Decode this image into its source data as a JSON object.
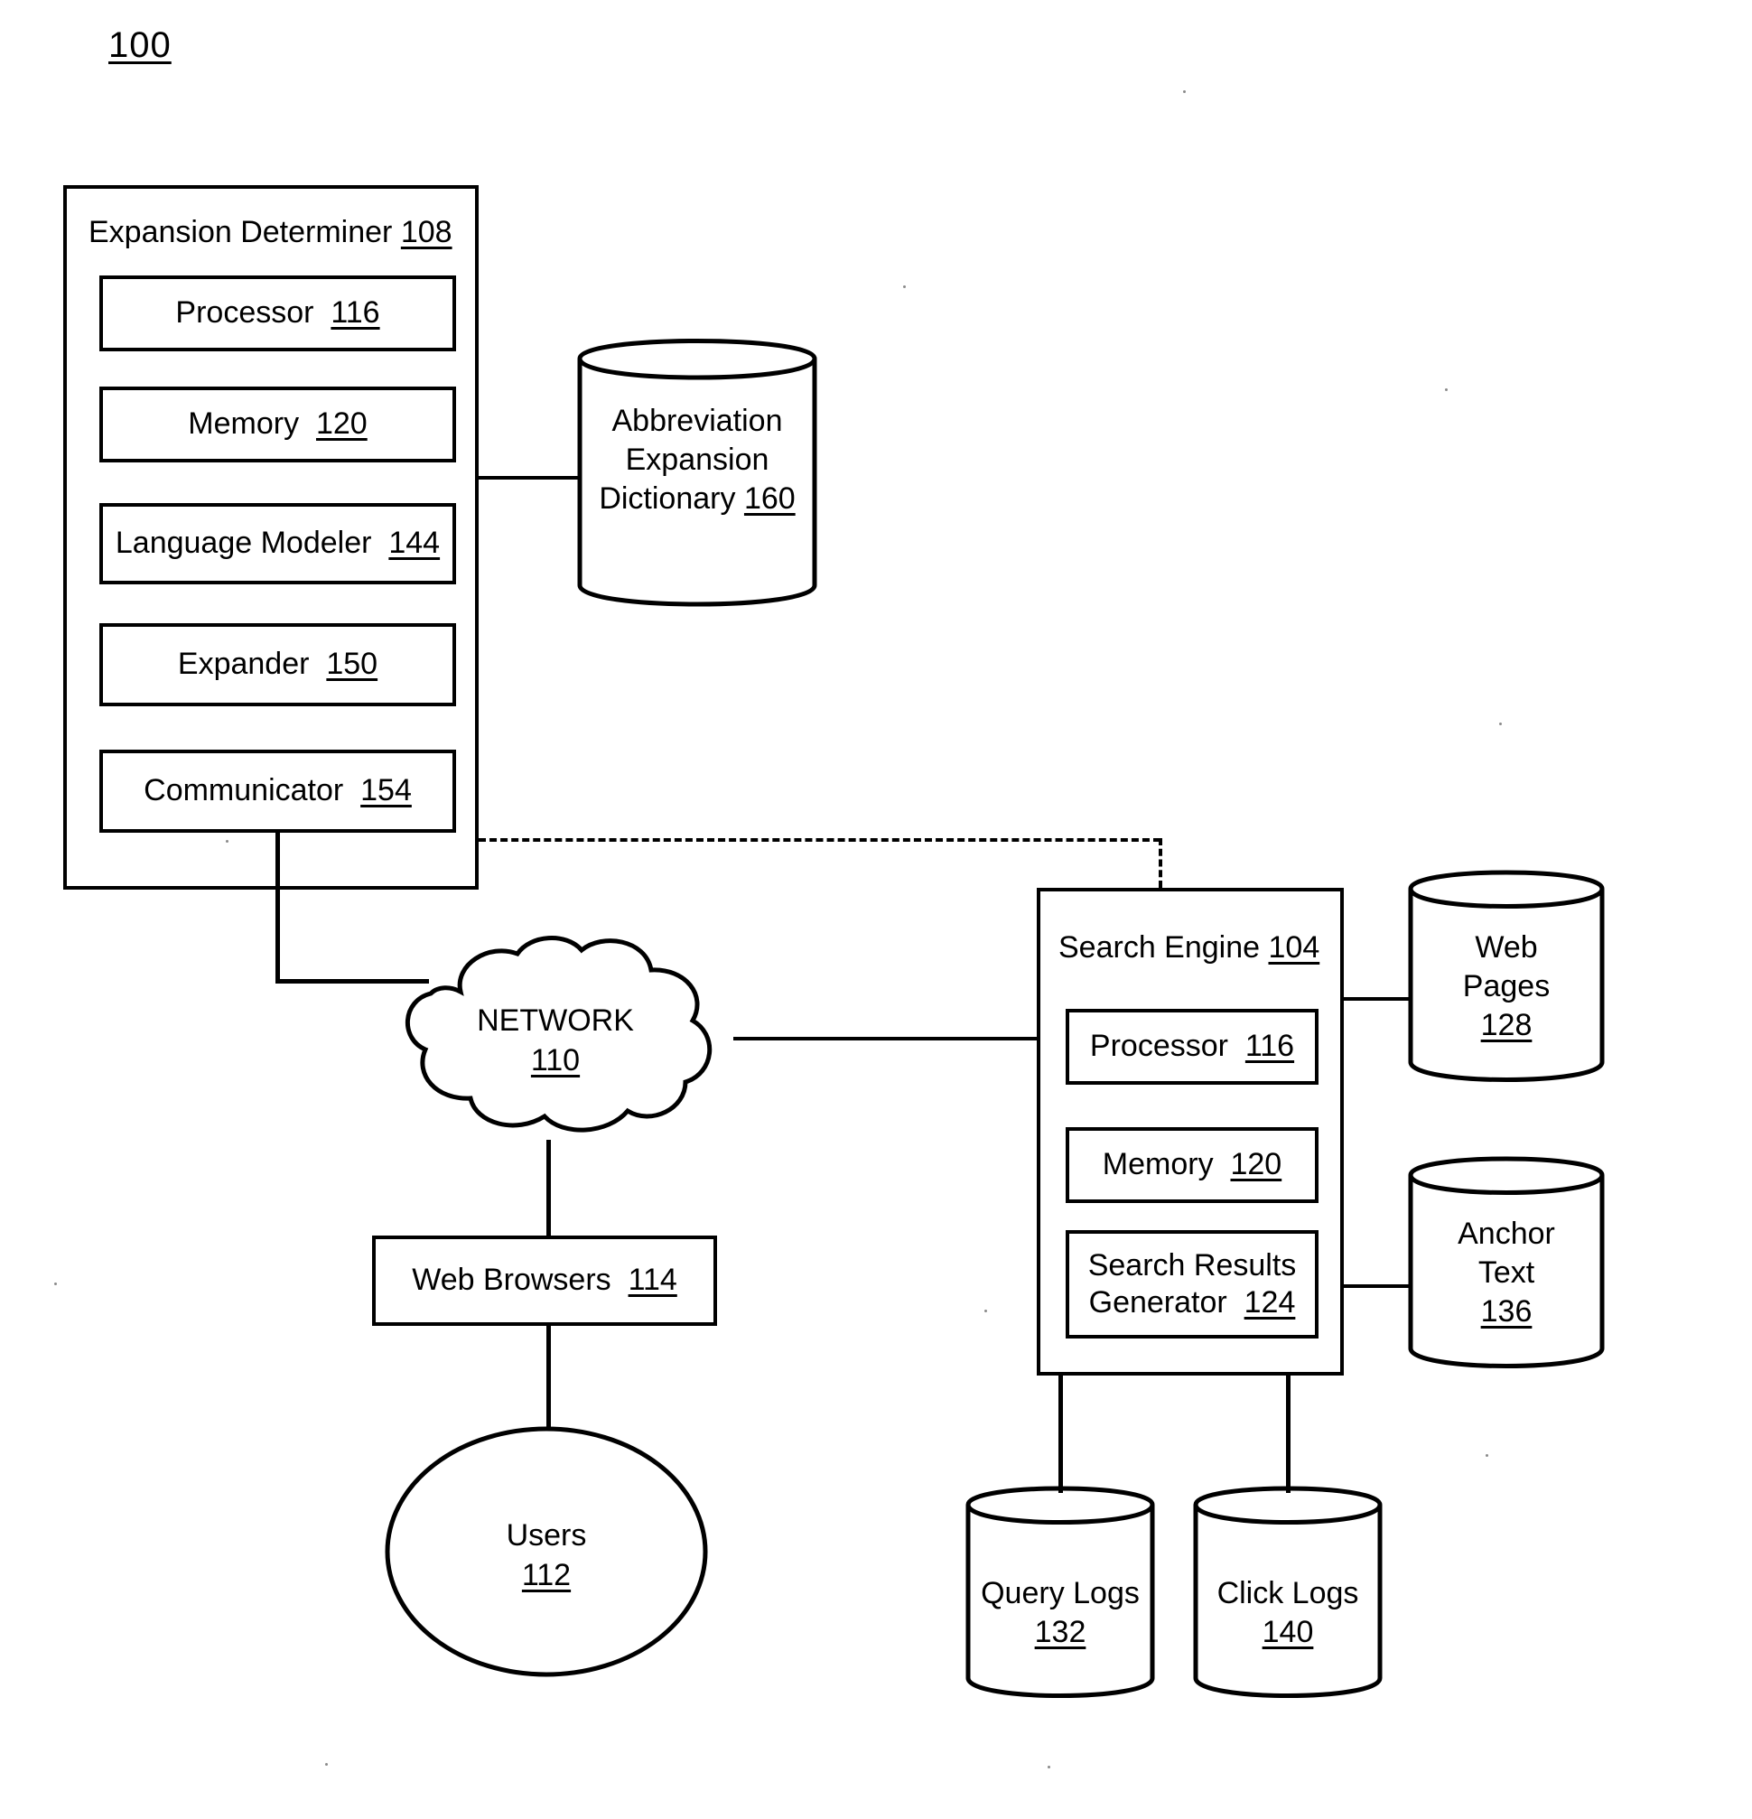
{
  "figure": {
    "number": "100"
  },
  "expansion_determiner": {
    "title_text": "Expansion Determiner",
    "title_ref": "108",
    "components": [
      {
        "text": "Processor",
        "ref": "116"
      },
      {
        "text": "Memory",
        "ref": "120"
      },
      {
        "text": "Language Modeler",
        "ref": "144"
      },
      {
        "text": "Expander",
        "ref": "150"
      },
      {
        "text": "Communicator",
        "ref": "154"
      }
    ]
  },
  "dictionary": {
    "lines": [
      "Abbreviation",
      "Expansion",
      "Dictionary"
    ],
    "ref": "160"
  },
  "network": {
    "label": "NETWORK",
    "ref": "110"
  },
  "web_browsers": {
    "text": "Web Browsers",
    "ref": "114"
  },
  "users": {
    "label": "Users",
    "ref": "112"
  },
  "search_engine": {
    "title_text": "Search Engine",
    "title_ref": "104",
    "components": [
      {
        "lines": [
          "Processor"
        ],
        "ref": "116"
      },
      {
        "lines": [
          "Memory"
        ],
        "ref": "120"
      },
      {
        "lines": [
          "Search Results",
          "Generator"
        ],
        "ref": "124"
      }
    ]
  },
  "datastores": {
    "web_pages": {
      "lines": [
        "Web",
        "Pages"
      ],
      "ref": "128"
    },
    "anchor_text": {
      "lines": [
        "Anchor",
        "Text"
      ],
      "ref": "136"
    },
    "query_logs": {
      "lines": [
        "Query Logs"
      ],
      "ref": "132"
    },
    "click_logs": {
      "lines": [
        "Click Logs"
      ],
      "ref": "140"
    }
  },
  "colors": {
    "ink": "#000000",
    "paper": "#ffffff"
  }
}
